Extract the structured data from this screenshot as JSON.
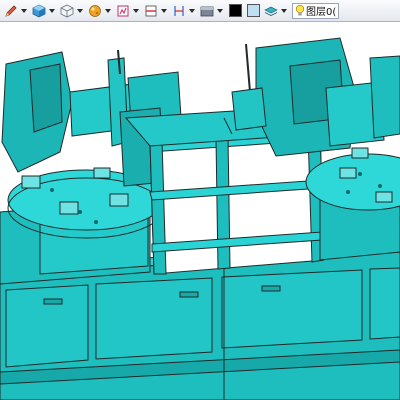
{
  "toolbar": {
    "groups": [
      {
        "icon": "pencil-draw-icon"
      },
      {
        "icon": "color-cube-icon"
      },
      {
        "icon": "wireframe-cube-icon"
      },
      {
        "icon": "material-sphere-icon"
      },
      {
        "icon": "texture-icon"
      },
      {
        "icon": "section-plane-icon"
      },
      {
        "icon": "dimension-icon"
      },
      {
        "icon": "display-style-icon"
      }
    ],
    "fill_colors": [
      "#000000",
      "#bfe0f2"
    ],
    "layer": {
      "icon": "lightbulb-icon",
      "label": "图层0("
    }
  },
  "viewport": {
    "model_color": "#21c8c8",
    "edge_color": "#1f2a2a",
    "background": "#ffffff"
  }
}
